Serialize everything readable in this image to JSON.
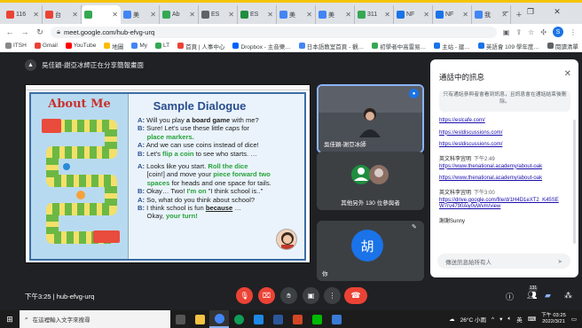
{
  "browser": {
    "tabs": [
      {
        "label": "116",
        "color": "#ea4335",
        "active": false
      },
      {
        "label": "台",
        "color": "#ea4335",
        "active": false
      },
      {
        "label": "",
        "color": "#34a853",
        "active": true
      },
      {
        "label": "美",
        "color": "#4285f4",
        "active": false
      },
      {
        "label": "Ab",
        "color": "#34a853",
        "active": false
      },
      {
        "label": "ES",
        "color": "#5f6368",
        "active": false
      },
      {
        "label": "ES",
        "color": "#1e8e3e",
        "active": false
      },
      {
        "label": "美",
        "color": "#4285f4",
        "active": false
      },
      {
        "label": "美",
        "color": "#4285f4",
        "active": false
      },
      {
        "label": "311",
        "color": "#34a853",
        "active": false
      },
      {
        "label": "NF",
        "color": "#1a73e8",
        "active": false
      },
      {
        "label": "NF",
        "color": "#1a73e8",
        "active": false
      },
      {
        "label": "我",
        "color": "#4285f4",
        "active": false
      }
    ],
    "new_tab": "+",
    "url": "meet.google.com/hub-efvg-urq",
    "profile_initial": "S",
    "bookmarks": [
      "ITSH",
      "Gmail",
      "YouTube",
      "地圖",
      "My",
      "LT",
      "首頁 | 人事中心",
      "Dropbox - 主音樂…",
      "日本語教室首頁 - 觀…",
      "初學者中高雷易…",
      "主站 - 建…",
      "英語會 109 學年度…",
      "閱讀清單"
    ]
  },
  "meet": {
    "presenter_banner": "吳佳穎-謝亞冰師正在分享簡報畫面",
    "slide": {
      "left_title": "About Me",
      "right_title": "Sample Dialogue",
      "lines": [
        [
          {
            "t": "A:",
            "c": "sp"
          },
          {
            "t": " Will you play "
          },
          {
            "t": "a board game",
            "c": "b"
          },
          {
            "t": " with me?"
          }
        ],
        [
          {
            "t": "B:",
            "c": "sp"
          },
          {
            "t": " Sure! Let's use these little caps for"
          }
        ],
        [
          {
            "t": "     "
          },
          {
            "t": "place markers.",
            "c": "hl"
          }
        ],
        [
          {
            "t": "A:",
            "c": "sp"
          },
          {
            "t": " And we can use coins instead of dice!"
          }
        ],
        [
          {
            "t": "B:",
            "c": "sp"
          },
          {
            "t": " Let's "
          },
          {
            "t": "flip a coin",
            "c": "hl"
          },
          {
            "t": " to see who starts. …"
          }
        ],
        [
          {
            "gap": true
          }
        ],
        [
          {
            "t": "A:",
            "c": "sp"
          },
          {
            "t": " Looks like you start. "
          },
          {
            "t": "Roll the dice",
            "c": "hl"
          }
        ],
        [
          {
            "t": "     [coin!] and move your "
          },
          {
            "t": "piece forward two",
            "c": "hl"
          }
        ],
        [
          {
            "t": "     "
          },
          {
            "t": "spaces",
            "c": "hl"
          },
          {
            "t": " for heads and one space for tails."
          }
        ],
        [
          {
            "t": "B:",
            "c": "sp"
          },
          {
            "t": " Okay… Two! "
          },
          {
            "t": "I'm on",
            "c": "hl"
          },
          {
            "t": " \"I think school is..\""
          }
        ],
        [
          {
            "t": "A:",
            "c": "sp"
          },
          {
            "t": " So, what do you think about school?"
          }
        ],
        [
          {
            "t": "B:",
            "c": "sp"
          },
          {
            "t": " I think school is fun "
          },
          {
            "t": "because",
            "c": "u"
          },
          {
            "t": " …"
          }
        ],
        [
          {
            "t": "     Okay, "
          },
          {
            "t": "your turn!",
            "c": "hl"
          }
        ]
      ]
    },
    "tiles": {
      "self_label": "吳佳穎-謝亞冰師",
      "others_label": "其他另外 130 位參與者",
      "avatar_initial": "胡",
      "avatar_label": "你"
    },
    "chat": {
      "title": "通話中的訊息",
      "notice": "只有通話參與者會看到訊息，且訊息會在通話結束後刪除。",
      "messages": [
        {
          "link": "https://eslcafe.com/"
        },
        {
          "link": "https://esldiscussions.com/"
        },
        {
          "link": "https://esldiscussions.com/"
        },
        {
          "sender": "英文科李宜明",
          "time": "下午2:49",
          "link": "https://www.thenational.academy/about-oak"
        },
        {
          "link": "https://www.thenational.academy/about-oak"
        },
        {
          "sender": "英文科李宜明",
          "time": "下午3:00",
          "link": "https://drive.google.com/file/d/1H4D1eXT2_K45SEW7rv4790Aiy0vWvm/view"
        },
        {
          "text": "謝謝Sunny"
        }
      ],
      "input_placeholder": "傳送訊息給所有人"
    },
    "controls": {
      "time_meeting": "下午3:25  |  hub-efvg-urq",
      "participants_badge": "131"
    }
  },
  "taskbar": {
    "search_placeholder": "在這裡輸入文字來搜尋",
    "weather": "26°C 小雨",
    "ime": "英",
    "time": "下午 03:25",
    "date": "2022/3/21"
  }
}
